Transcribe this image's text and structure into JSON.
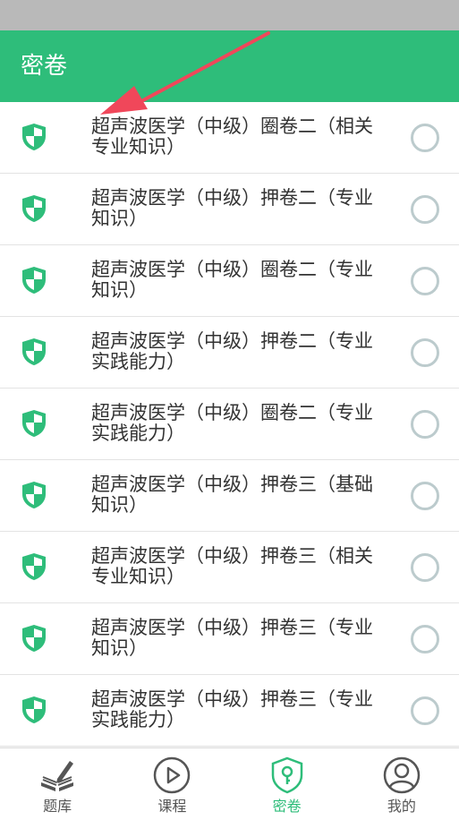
{
  "header": {
    "title": "密卷"
  },
  "items": [
    {
      "text": "超声波医学（中级）圈卷二（相关专业知识）"
    },
    {
      "text": "超声波医学（中级）押卷二（专业知识）"
    },
    {
      "text": "超声波医学（中级）圈卷二（专业知识）"
    },
    {
      "text": "超声波医学（中级）押卷二（专业实践能力）"
    },
    {
      "text": "超声波医学（中级）圈卷二（专业实践能力）"
    },
    {
      "text": "超声波医学（中级）押卷三（基础知识）"
    },
    {
      "text": "超声波医学（中级）押卷三（相关专业知识）"
    },
    {
      "text": "超声波医学（中级）押卷三（专业知识）"
    },
    {
      "text": "超声波医学（中级）押卷三（专业实践能力）"
    }
  ],
  "tabs": [
    {
      "label": "题库",
      "icon": "book-pen-icon"
    },
    {
      "label": "课程",
      "icon": "play-circle-icon"
    },
    {
      "label": "密卷",
      "icon": "lock-shield-icon",
      "active": true
    },
    {
      "label": "我的",
      "icon": "user-circle-icon"
    }
  ],
  "colors": {
    "accent": "#2ebd7a",
    "radio": "#bccbcd",
    "annotation": "#f0475a"
  }
}
